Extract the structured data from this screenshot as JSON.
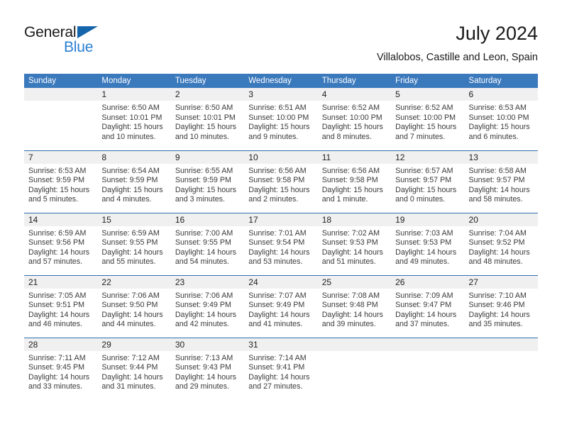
{
  "brand": {
    "name_part1": "General",
    "name_part2": "Blue",
    "triangle_icon": "triangle-icon",
    "color_dark": "#1a1a1a",
    "color_blue": "#2a7fd4"
  },
  "header": {
    "title": "July 2024",
    "subtitle": "Villalobos, Castille and Leon, Spain"
  },
  "theme": {
    "header_bg": "#3b79bd",
    "header_text": "#ffffff",
    "daynum_bg": "#f0f0f0",
    "row_divider": "#2f6fb0",
    "body_text": "#3a3a3a"
  },
  "calendar": {
    "weekday_headers": [
      "Sunday",
      "Monday",
      "Tuesday",
      "Wednesday",
      "Thursday",
      "Friday",
      "Saturday"
    ],
    "weeks": [
      [
        {
          "day": "",
          "sunrise": "",
          "sunset": "",
          "daylight_line1": "",
          "daylight_line2": ""
        },
        {
          "day": "1",
          "sunrise": "Sunrise: 6:50 AM",
          "sunset": "Sunset: 10:01 PM",
          "daylight_line1": "Daylight: 15 hours",
          "daylight_line2": "and 10 minutes."
        },
        {
          "day": "2",
          "sunrise": "Sunrise: 6:50 AM",
          "sunset": "Sunset: 10:01 PM",
          "daylight_line1": "Daylight: 15 hours",
          "daylight_line2": "and 10 minutes."
        },
        {
          "day": "3",
          "sunrise": "Sunrise: 6:51 AM",
          "sunset": "Sunset: 10:00 PM",
          "daylight_line1": "Daylight: 15 hours",
          "daylight_line2": "and 9 minutes."
        },
        {
          "day": "4",
          "sunrise": "Sunrise: 6:52 AM",
          "sunset": "Sunset: 10:00 PM",
          "daylight_line1": "Daylight: 15 hours",
          "daylight_line2": "and 8 minutes."
        },
        {
          "day": "5",
          "sunrise": "Sunrise: 6:52 AM",
          "sunset": "Sunset: 10:00 PM",
          "daylight_line1": "Daylight: 15 hours",
          "daylight_line2": "and 7 minutes."
        },
        {
          "day": "6",
          "sunrise": "Sunrise: 6:53 AM",
          "sunset": "Sunset: 10:00 PM",
          "daylight_line1": "Daylight: 15 hours",
          "daylight_line2": "and 6 minutes."
        }
      ],
      [
        {
          "day": "7",
          "sunrise": "Sunrise: 6:53 AM",
          "sunset": "Sunset: 9:59 PM",
          "daylight_line1": "Daylight: 15 hours",
          "daylight_line2": "and 5 minutes."
        },
        {
          "day": "8",
          "sunrise": "Sunrise: 6:54 AM",
          "sunset": "Sunset: 9:59 PM",
          "daylight_line1": "Daylight: 15 hours",
          "daylight_line2": "and 4 minutes."
        },
        {
          "day": "9",
          "sunrise": "Sunrise: 6:55 AM",
          "sunset": "Sunset: 9:59 PM",
          "daylight_line1": "Daylight: 15 hours",
          "daylight_line2": "and 3 minutes."
        },
        {
          "day": "10",
          "sunrise": "Sunrise: 6:56 AM",
          "sunset": "Sunset: 9:58 PM",
          "daylight_line1": "Daylight: 15 hours",
          "daylight_line2": "and 2 minutes."
        },
        {
          "day": "11",
          "sunrise": "Sunrise: 6:56 AM",
          "sunset": "Sunset: 9:58 PM",
          "daylight_line1": "Daylight: 15 hours",
          "daylight_line2": "and 1 minute."
        },
        {
          "day": "12",
          "sunrise": "Sunrise: 6:57 AM",
          "sunset": "Sunset: 9:57 PM",
          "daylight_line1": "Daylight: 15 hours",
          "daylight_line2": "and 0 minutes."
        },
        {
          "day": "13",
          "sunrise": "Sunrise: 6:58 AM",
          "sunset": "Sunset: 9:57 PM",
          "daylight_line1": "Daylight: 14 hours",
          "daylight_line2": "and 58 minutes."
        }
      ],
      [
        {
          "day": "14",
          "sunrise": "Sunrise: 6:59 AM",
          "sunset": "Sunset: 9:56 PM",
          "daylight_line1": "Daylight: 14 hours",
          "daylight_line2": "and 57 minutes."
        },
        {
          "day": "15",
          "sunrise": "Sunrise: 6:59 AM",
          "sunset": "Sunset: 9:55 PM",
          "daylight_line1": "Daylight: 14 hours",
          "daylight_line2": "and 55 minutes."
        },
        {
          "day": "16",
          "sunrise": "Sunrise: 7:00 AM",
          "sunset": "Sunset: 9:55 PM",
          "daylight_line1": "Daylight: 14 hours",
          "daylight_line2": "and 54 minutes."
        },
        {
          "day": "17",
          "sunrise": "Sunrise: 7:01 AM",
          "sunset": "Sunset: 9:54 PM",
          "daylight_line1": "Daylight: 14 hours",
          "daylight_line2": "and 53 minutes."
        },
        {
          "day": "18",
          "sunrise": "Sunrise: 7:02 AM",
          "sunset": "Sunset: 9:53 PM",
          "daylight_line1": "Daylight: 14 hours",
          "daylight_line2": "and 51 minutes."
        },
        {
          "day": "19",
          "sunrise": "Sunrise: 7:03 AM",
          "sunset": "Sunset: 9:53 PM",
          "daylight_line1": "Daylight: 14 hours",
          "daylight_line2": "and 49 minutes."
        },
        {
          "day": "20",
          "sunrise": "Sunrise: 7:04 AM",
          "sunset": "Sunset: 9:52 PM",
          "daylight_line1": "Daylight: 14 hours",
          "daylight_line2": "and 48 minutes."
        }
      ],
      [
        {
          "day": "21",
          "sunrise": "Sunrise: 7:05 AM",
          "sunset": "Sunset: 9:51 PM",
          "daylight_line1": "Daylight: 14 hours",
          "daylight_line2": "and 46 minutes."
        },
        {
          "day": "22",
          "sunrise": "Sunrise: 7:06 AM",
          "sunset": "Sunset: 9:50 PM",
          "daylight_line1": "Daylight: 14 hours",
          "daylight_line2": "and 44 minutes."
        },
        {
          "day": "23",
          "sunrise": "Sunrise: 7:06 AM",
          "sunset": "Sunset: 9:49 PM",
          "daylight_line1": "Daylight: 14 hours",
          "daylight_line2": "and 42 minutes."
        },
        {
          "day": "24",
          "sunrise": "Sunrise: 7:07 AM",
          "sunset": "Sunset: 9:49 PM",
          "daylight_line1": "Daylight: 14 hours",
          "daylight_line2": "and 41 minutes."
        },
        {
          "day": "25",
          "sunrise": "Sunrise: 7:08 AM",
          "sunset": "Sunset: 9:48 PM",
          "daylight_line1": "Daylight: 14 hours",
          "daylight_line2": "and 39 minutes."
        },
        {
          "day": "26",
          "sunrise": "Sunrise: 7:09 AM",
          "sunset": "Sunset: 9:47 PM",
          "daylight_line1": "Daylight: 14 hours",
          "daylight_line2": "and 37 minutes."
        },
        {
          "day": "27",
          "sunrise": "Sunrise: 7:10 AM",
          "sunset": "Sunset: 9:46 PM",
          "daylight_line1": "Daylight: 14 hours",
          "daylight_line2": "and 35 minutes."
        }
      ],
      [
        {
          "day": "28",
          "sunrise": "Sunrise: 7:11 AM",
          "sunset": "Sunset: 9:45 PM",
          "daylight_line1": "Daylight: 14 hours",
          "daylight_line2": "and 33 minutes."
        },
        {
          "day": "29",
          "sunrise": "Sunrise: 7:12 AM",
          "sunset": "Sunset: 9:44 PM",
          "daylight_line1": "Daylight: 14 hours",
          "daylight_line2": "and 31 minutes."
        },
        {
          "day": "30",
          "sunrise": "Sunrise: 7:13 AM",
          "sunset": "Sunset: 9:43 PM",
          "daylight_line1": "Daylight: 14 hours",
          "daylight_line2": "and 29 minutes."
        },
        {
          "day": "31",
          "sunrise": "Sunrise: 7:14 AM",
          "sunset": "Sunset: 9:41 PM",
          "daylight_line1": "Daylight: 14 hours",
          "daylight_line2": "and 27 minutes."
        },
        {
          "day": "",
          "sunrise": "",
          "sunset": "",
          "daylight_line1": "",
          "daylight_line2": ""
        },
        {
          "day": "",
          "sunrise": "",
          "sunset": "",
          "daylight_line1": "",
          "daylight_line2": ""
        },
        {
          "day": "",
          "sunrise": "",
          "sunset": "",
          "daylight_line1": "",
          "daylight_line2": ""
        }
      ]
    ]
  }
}
